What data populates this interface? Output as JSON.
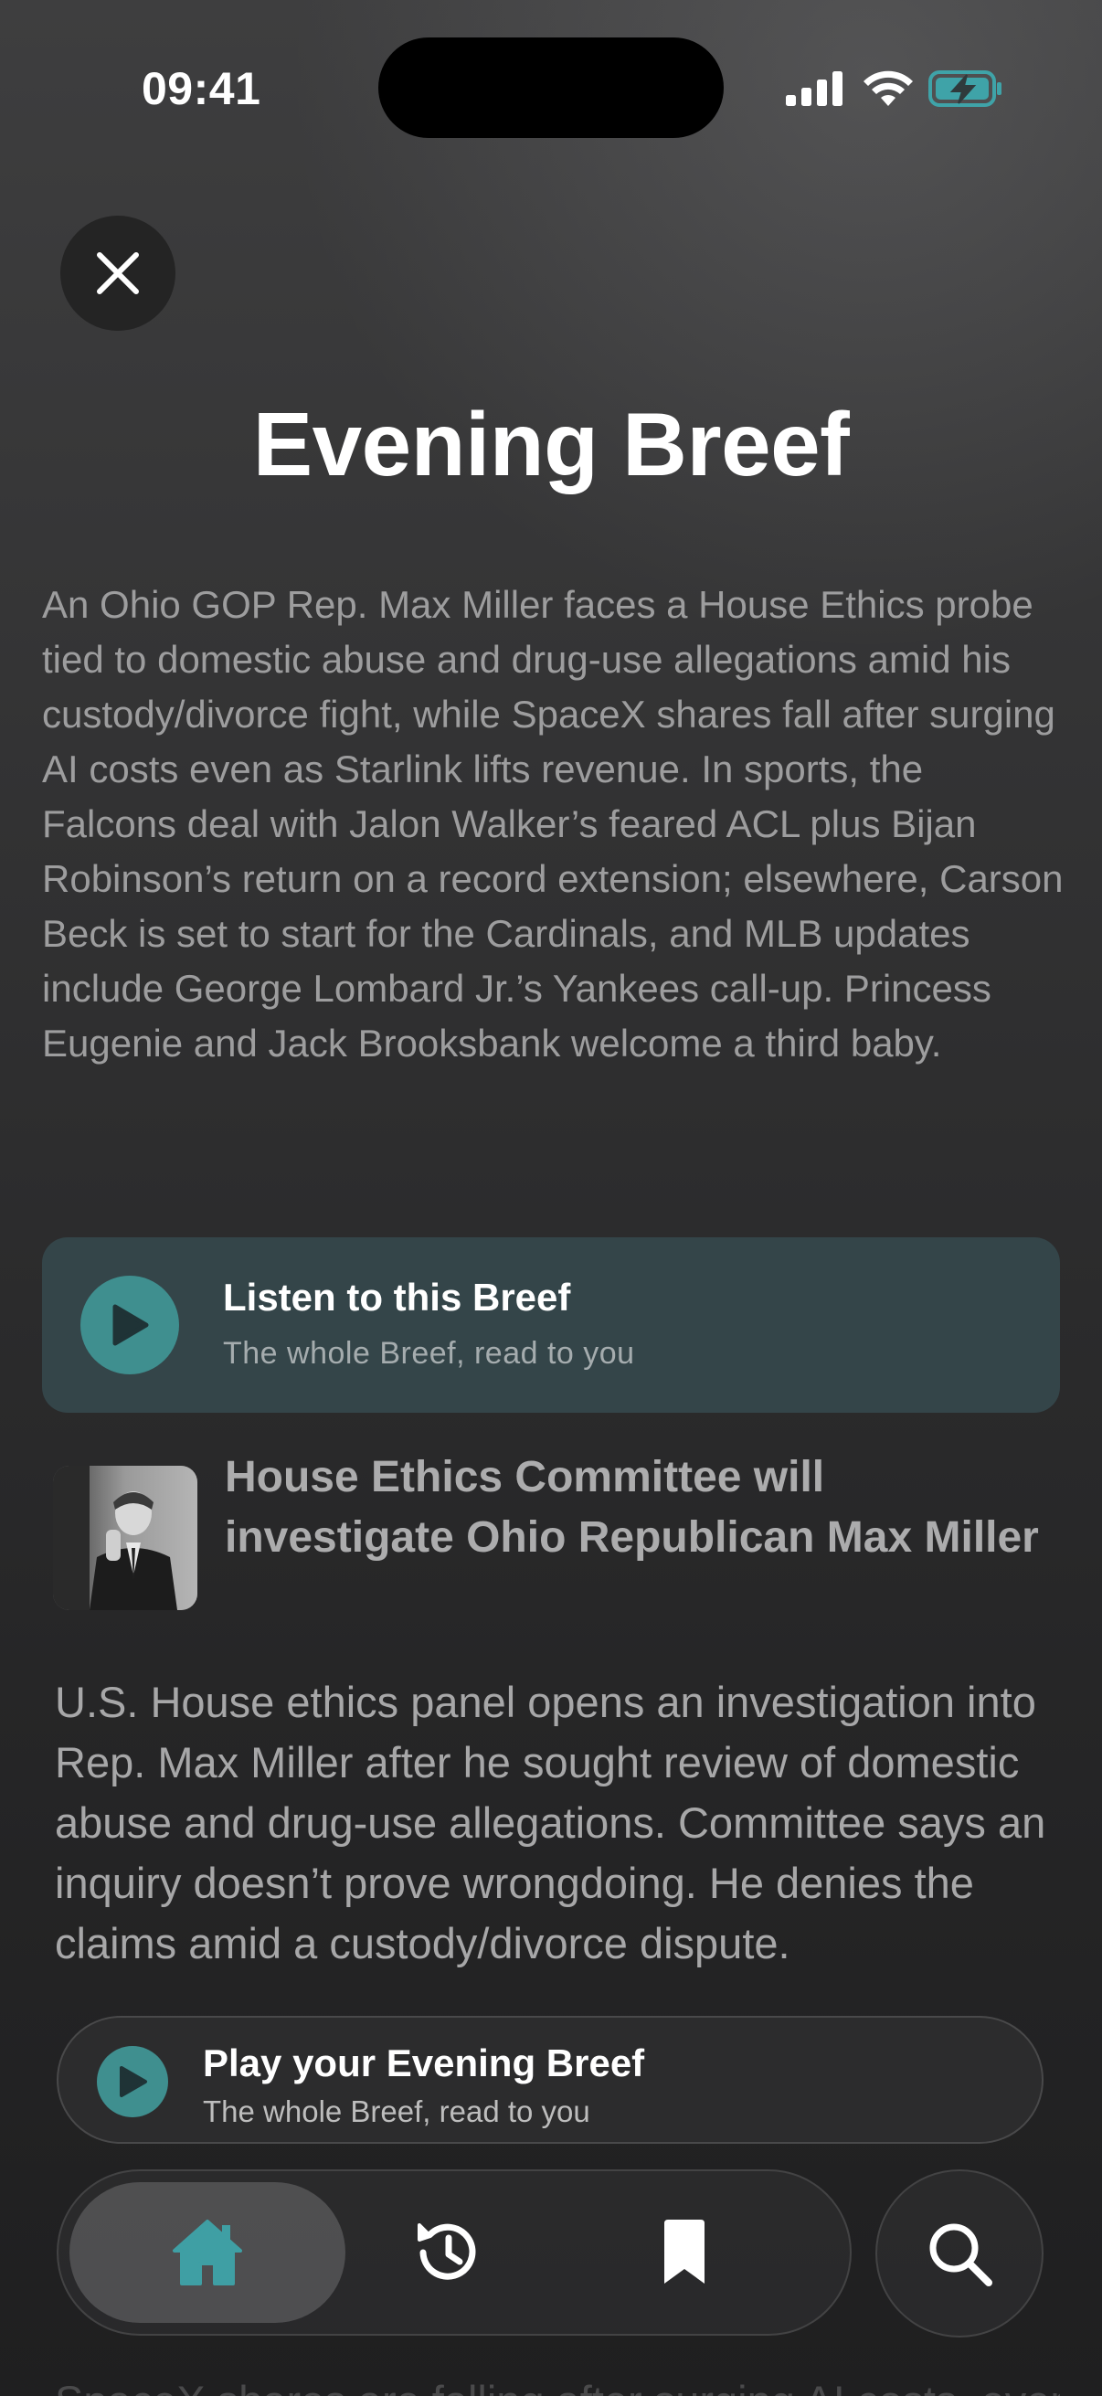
{
  "status_bar": {
    "time": "09:41",
    "icons": [
      "signal-icon",
      "wifi-icon",
      "battery-charging-icon"
    ]
  },
  "header": {
    "close_icon": "close-icon",
    "title": "Evening Breef"
  },
  "summary": "An Ohio GOP Rep. Max Miller faces a House Ethics probe tied to domestic abuse and drug-use allegations amid his custody/divorce fight, while SpaceX shares fall after surging AI costs even as Starlink lifts revenue. In sports, the Falcons deal with Jalon Walker’s feared ACL plus Bijan Robinson’s return on a record extension; elsewhere, Carson Beck is set to start for the Cardinals, and MLB updates include George Lombard Jr.’s Yankees call-up. Princess Eugenie and Jack Brooksbank welcome a third baby.",
  "listen_card": {
    "title": "Listen to this Breef",
    "subtitle": "The whole Breef, read to you",
    "icon": "play-icon",
    "accent_color": "#3f8f8f"
  },
  "article": {
    "headline": "House Ethics Committee will investigate Ohio Republican Max Miller",
    "body": "U.S. House ethics panel opens an investigation into Rep. Max Miller after he sought review of domestic abuse and drug-use allegations. Committee says an inquiry doesn’t prove wrongdoing. He denies the claims amid a custody/divorce dispute.",
    "thumbnail": "article-photo"
  },
  "next_article": {
    "body_start": "SpaceX shares are falling after surging AI costs, even as Starlink"
  },
  "player_bar": {
    "title": "Play your Evening Breef",
    "subtitle": "The whole Breef, read to you",
    "icon": "play-icon"
  },
  "tab_bar": {
    "tabs": [
      {
        "name": "home",
        "icon": "home-icon",
        "selected": true,
        "color": "#3f9fa4"
      },
      {
        "name": "history",
        "icon": "history-icon",
        "selected": false
      },
      {
        "name": "saved",
        "icon": "bookmark-icon",
        "selected": false
      }
    ],
    "search_icon": "search-icon"
  }
}
